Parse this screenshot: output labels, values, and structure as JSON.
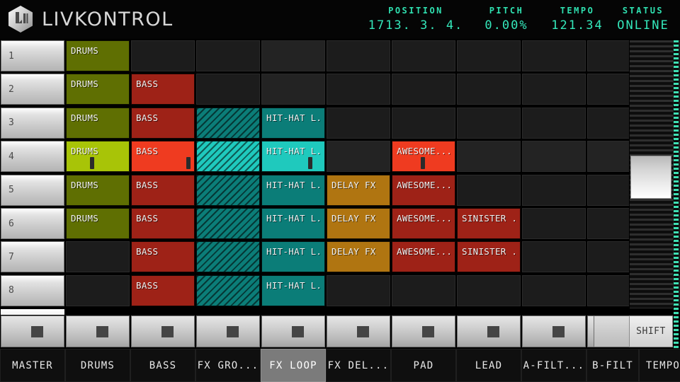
{
  "app": {
    "brand": "LIVKONTROL",
    "logo_icon": "livkontrol-hex-logo"
  },
  "header": {
    "stats": [
      {
        "label": "POSITION",
        "value": "1713. 3. 4."
      },
      {
        "label": "PITCH",
        "value": "0.00%"
      },
      {
        "label": "TEMPO",
        "value": "121.34"
      },
      {
        "label": "STATUS",
        "value": "ONLINE"
      }
    ],
    "accent_color": "#34e8bb"
  },
  "grid": {
    "scenes": [
      "1",
      "2",
      "3",
      "4",
      "5",
      "6",
      "7",
      "8"
    ],
    "colors": {
      "drums": "#5f6f02",
      "drums_active": "#a8c407",
      "bass": "#9e2217",
      "bass_active": "#ef3b20",
      "teal": "#0b7d78",
      "teal_active": "#1fc9bd",
      "gold": "#b07511",
      "empty": "#1c1c1c",
      "empty_alt": "#232323"
    },
    "rows": [
      [
        {
          "label": "DRUMS",
          "state": "stopped",
          "color": "drums"
        },
        {
          "label": "",
          "state": "empty"
        },
        {
          "label": "",
          "state": "empty"
        },
        {
          "label": "",
          "state": "empty",
          "alt": true
        },
        {
          "label": "",
          "state": "empty"
        },
        {
          "label": "",
          "state": "empty"
        },
        {
          "label": "",
          "state": "empty"
        },
        {
          "label": "",
          "state": "empty"
        },
        {
          "label": "",
          "state": "empty"
        },
        {
          "label": "",
          "state": "empty"
        }
      ],
      [
        {
          "label": "DRUMS",
          "state": "stopped",
          "color": "drums"
        },
        {
          "label": "BASS",
          "state": "stopped",
          "color": "bass"
        },
        {
          "label": "",
          "state": "empty"
        },
        {
          "label": "",
          "state": "empty",
          "alt": true
        },
        {
          "label": "",
          "state": "empty"
        },
        {
          "label": "",
          "state": "empty"
        },
        {
          "label": "",
          "state": "empty"
        },
        {
          "label": "",
          "state": "empty"
        },
        {
          "label": "",
          "state": "empty"
        },
        {
          "label": "",
          "state": "empty"
        }
      ],
      [
        {
          "label": "DRUMS",
          "state": "stopped",
          "color": "drums"
        },
        {
          "label": "BASS",
          "state": "stopped",
          "color": "bass"
        },
        {
          "label": "",
          "state": "stopped",
          "color": "teal",
          "hatch": true
        },
        {
          "label": "HIT-HAT L...",
          "state": "stopped",
          "color": "teal"
        },
        {
          "label": "",
          "state": "empty"
        },
        {
          "label": "",
          "state": "empty"
        },
        {
          "label": "",
          "state": "empty"
        },
        {
          "label": "",
          "state": "empty"
        },
        {
          "label": "",
          "state": "empty"
        },
        {
          "label": "",
          "state": "empty"
        }
      ],
      [
        {
          "label": "DRUMS",
          "state": "playing",
          "color": "drums_active",
          "progress": 38
        },
        {
          "label": "BASS",
          "state": "playing",
          "color": "bass_active",
          "progress": 87
        },
        {
          "label": "",
          "state": "playing",
          "color": "teal_active",
          "hatch": true
        },
        {
          "label": "HIT-HAT L...",
          "state": "playing",
          "color": "teal_active",
          "progress": 74
        },
        {
          "label": "",
          "state": "empty",
          "alt": true
        },
        {
          "label": "AWESOME...",
          "state": "playing",
          "color": "bass_active",
          "progress": 46
        },
        {
          "label": "",
          "state": "empty",
          "alt": true
        },
        {
          "label": "",
          "state": "empty",
          "alt": true
        },
        {
          "label": "",
          "state": "empty",
          "alt": true
        },
        {
          "label": "",
          "state": "empty",
          "alt": true
        }
      ],
      [
        {
          "label": "DRUMS",
          "state": "stopped",
          "color": "drums"
        },
        {
          "label": "BASS",
          "state": "stopped",
          "color": "bass"
        },
        {
          "label": "",
          "state": "stopped",
          "color": "teal",
          "hatch": true
        },
        {
          "label": "HIT-HAT L...",
          "state": "stopped",
          "color": "teal"
        },
        {
          "label": "DELAY FX",
          "state": "stopped",
          "color": "gold"
        },
        {
          "label": "AWESOME...",
          "state": "stopped",
          "color": "bass"
        },
        {
          "label": "",
          "state": "empty"
        },
        {
          "label": "",
          "state": "empty"
        },
        {
          "label": "",
          "state": "empty"
        },
        {
          "label": "",
          "state": "empty"
        }
      ],
      [
        {
          "label": "DRUMS",
          "state": "stopped",
          "color": "drums"
        },
        {
          "label": "BASS",
          "state": "stopped",
          "color": "bass"
        },
        {
          "label": "",
          "state": "stopped",
          "color": "teal",
          "hatch": true
        },
        {
          "label": "HIT-HAT L...",
          "state": "stopped",
          "color": "teal"
        },
        {
          "label": "DELAY FX",
          "state": "stopped",
          "color": "gold"
        },
        {
          "label": "AWESOME...",
          "state": "stopped",
          "color": "bass"
        },
        {
          "label": "SINISTER ...",
          "state": "stopped",
          "color": "bass"
        },
        {
          "label": "",
          "state": "empty"
        },
        {
          "label": "",
          "state": "empty"
        },
        {
          "label": "",
          "state": "empty"
        }
      ],
      [
        {
          "label": "",
          "state": "empty"
        },
        {
          "label": "BASS",
          "state": "stopped",
          "color": "bass"
        },
        {
          "label": "",
          "state": "stopped",
          "color": "teal",
          "hatch": true
        },
        {
          "label": "HIT-HAT L...",
          "state": "stopped",
          "color": "teal"
        },
        {
          "label": "DELAY FX",
          "state": "stopped",
          "color": "gold"
        },
        {
          "label": "AWESOME...",
          "state": "stopped",
          "color": "bass"
        },
        {
          "label": "SINISTER ...",
          "state": "stopped",
          "color": "bass"
        },
        {
          "label": "",
          "state": "empty"
        },
        {
          "label": "",
          "state": "empty"
        },
        {
          "label": "",
          "state": "empty"
        }
      ],
      [
        {
          "label": "",
          "state": "empty"
        },
        {
          "label": "BASS",
          "state": "stopped",
          "color": "bass"
        },
        {
          "label": "",
          "state": "stopped",
          "color": "teal",
          "hatch": true
        },
        {
          "label": "HIT-HAT L...",
          "state": "stopped",
          "color": "teal"
        },
        {
          "label": "",
          "state": "empty"
        },
        {
          "label": "",
          "state": "empty"
        },
        {
          "label": "",
          "state": "empty"
        },
        {
          "label": "",
          "state": "empty"
        },
        {
          "label": "",
          "state": "empty"
        },
        {
          "label": "",
          "state": "empty"
        }
      ]
    ]
  },
  "scrollbar": {
    "thumb_top_pct": 43,
    "thumb_height_pct": 16
  },
  "stop_row": {
    "icon": "stop-square-icon",
    "count": 10,
    "shift_label": "SHIFT"
  },
  "tracks": [
    {
      "name": "MASTER",
      "selected": false
    },
    {
      "name": "DRUMS",
      "selected": false
    },
    {
      "name": "BASS",
      "selected": false
    },
    {
      "name": "FX GRO...",
      "selected": false
    },
    {
      "name": "FX LOOP",
      "selected": true
    },
    {
      "name": "FX DEL...",
      "selected": false
    },
    {
      "name": "PAD",
      "selected": false
    },
    {
      "name": "LEAD",
      "selected": false
    },
    {
      "name": "A-FILT...",
      "selected": false
    },
    {
      "name": "B-FILT",
      "selected": false
    },
    {
      "name": "TEMPO",
      "selected": false
    }
  ]
}
